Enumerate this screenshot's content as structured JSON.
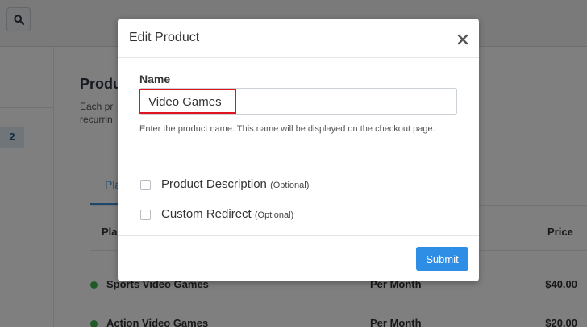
{
  "background": {
    "page_badge": "2",
    "section_title": "Produ",
    "description_line1": "Each pr",
    "description_line2": "recurrin",
    "tab_label": "Pla",
    "table": {
      "col_plan": "Pla",
      "col_price": "Price",
      "rows": [
        {
          "name": "Sports Video Games",
          "frequency": "Per Month",
          "price": "$40.00"
        },
        {
          "name": "Action Video Games",
          "frequency": "Per Month",
          "price": "$20.00"
        }
      ]
    }
  },
  "modal": {
    "title": "Edit Product",
    "close_glyph": "×",
    "name_label": "Name",
    "name_value": "Video Games",
    "help_text": "Enter the product name. This name will be displayed on the checkout page.",
    "options": [
      {
        "label": "Product Description",
        "optional": "(Optional)"
      },
      {
        "label": "Custom Redirect",
        "optional": "(Optional)"
      }
    ],
    "submit_label": "Submit"
  },
  "colors": {
    "accent": "#2e8ee6",
    "highlight": "#e0141e",
    "status_active": "#3cb44b"
  }
}
